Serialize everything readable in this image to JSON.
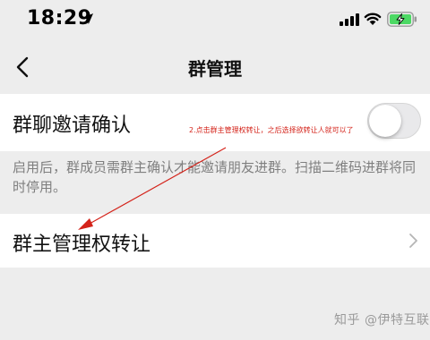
{
  "status_bar": {
    "time": "18:29",
    "icons": [
      "location-arrow-icon",
      "signal-icon",
      "wifi-icon",
      "battery-charging-icon"
    ],
    "battery_color": "#4cd964"
  },
  "nav": {
    "title": "群管理",
    "back_icon": "chevron-left-icon"
  },
  "settings": {
    "invite_confirm": {
      "label": "群聊邀请确认",
      "toggle_on": false
    },
    "description": "启用后，群成员需群主确认才能邀请朋友进群。扫描二维码进群将同时停用。",
    "transfer_owner": {
      "label": "群主管理权转让",
      "chevron_icon": "chevron-right-icon"
    }
  },
  "annotation": {
    "text": "2.点击群主管理权转让，之后选择欲转让人就可以了",
    "color": "#d4231a"
  },
  "watermark": {
    "text": "知乎 @伊特互联"
  }
}
